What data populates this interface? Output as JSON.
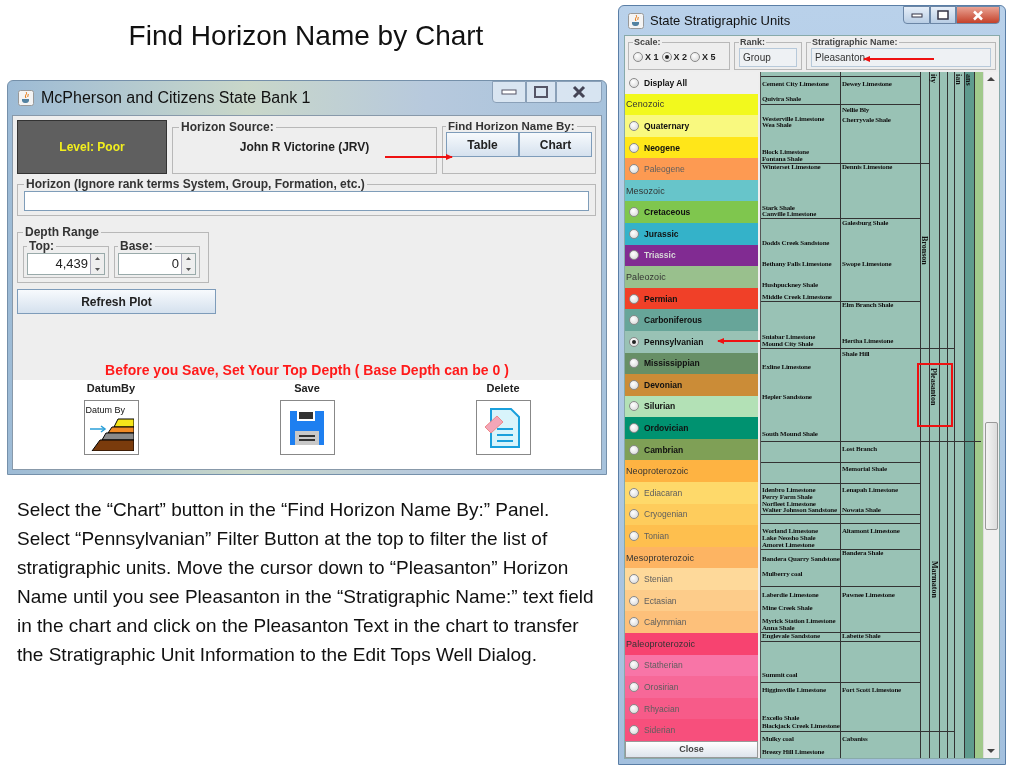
{
  "slide": {
    "title": "Find Horizon Name by Chart",
    "instructions": "Select the “Chart” button in the “Find Horizon Name By:” Panel. Select “Pennsylvanian” Filter Button at the top to filter the list of stratigraphic units. Move the cursor down to “Pleasanton” Horizon Name until you see Pleasanton in the “Stratigraphic Name:” text field in the chart and click on the Pleasanton Text in the chart to transfer the Stratigraphic Unit Information to the Edit Tops Well Dialog."
  },
  "edit_window": {
    "title": "McPherson and Citizens State Bank 1",
    "level": "Level: Poor",
    "horizon_source": {
      "label": "Horizon Source:",
      "value": "John R Victorine (JRV)"
    },
    "find_by": {
      "label": "Find Horizon Name By:",
      "buttons": [
        "Table",
        "Chart"
      ]
    },
    "horizon": {
      "label": "Horizon (Ignore rank terms System, Group, Formation, etc.)"
    },
    "depth_range": {
      "label": "Depth Range",
      "top": {
        "label": "Top:",
        "value": "4,439"
      },
      "base": {
        "label": "Base:",
        "value": "0"
      }
    },
    "refresh_button": "Refresh Plot",
    "warning": "Before you Save, Set Your Top Depth ( Base Depth can be 0 )",
    "actions": [
      {
        "label": "DatumBy",
        "kind": "datum",
        "icon_text": "Datum By"
      },
      {
        "label": "Save",
        "kind": "save"
      },
      {
        "label": "Delete",
        "kind": "delete"
      }
    ]
  },
  "strat_window": {
    "title": "State Stratigraphic Units",
    "scale": {
      "label": "Scale:",
      "options": [
        {
          "label": "X 1",
          "selected": false
        },
        {
          "label": "X 2",
          "selected": true
        },
        {
          "label": "X 5",
          "selected": false
        }
      ]
    },
    "rank": {
      "label": "Rank:",
      "value": "Group"
    },
    "name": {
      "label": "Stratigraphic Name:",
      "value": "Pleasanton"
    },
    "filters": [
      {
        "kind": "radio",
        "label": "Display All",
        "color": "#efefef",
        "selected": false,
        "disabled": false
      },
      {
        "kind": "header",
        "label": "Cenozoic",
        "color": "#f2f91d",
        "disabled": false
      },
      {
        "kind": "radio",
        "label": "Quaternary",
        "color": "#f9f97f",
        "selected": false,
        "disabled": false
      },
      {
        "kind": "radio",
        "label": "Neogene",
        "color": "#ffe619",
        "selected": false,
        "disabled": false
      },
      {
        "kind": "radio",
        "label": "Paleogene",
        "color": "#fd9a52",
        "selected": false,
        "disabled": true
      },
      {
        "kind": "header",
        "label": "Mesozoic",
        "color": "#67c5ca",
        "disabled": false
      },
      {
        "kind": "radio",
        "label": "Cretaceous",
        "color": "#7fc64e",
        "selected": false,
        "disabled": false
      },
      {
        "kind": "radio",
        "label": "Jurassic",
        "color": "#34b2c9",
        "selected": false,
        "disabled": false
      },
      {
        "kind": "radio",
        "label": "Triassic",
        "color": "#812b92",
        "selected": false,
        "disabled": true
      },
      {
        "kind": "header",
        "label": "Paleozoic",
        "color": "#99c08d",
        "disabled": false
      },
      {
        "kind": "radio",
        "label": "Permian",
        "color": "#f04028",
        "selected": false,
        "disabled": false
      },
      {
        "kind": "radio",
        "label": "Carboniferous",
        "color": "#67a599",
        "selected": false,
        "disabled": false
      },
      {
        "kind": "radio",
        "label": "Pennsylvanian",
        "color": "#99c2b5",
        "selected": true,
        "disabled": false
      },
      {
        "kind": "radio",
        "label": "Mississippian",
        "color": "#678f66",
        "selected": false,
        "disabled": false
      },
      {
        "kind": "radio",
        "label": "Devonian",
        "color": "#cb8c37",
        "selected": false,
        "disabled": false
      },
      {
        "kind": "radio",
        "label": "Silurian",
        "color": "#b3e1b6",
        "selected": false,
        "disabled": false
      },
      {
        "kind": "radio",
        "label": "Ordovician",
        "color": "#009270",
        "selected": false,
        "disabled": false
      },
      {
        "kind": "radio",
        "label": "Cambrian",
        "color": "#7fa056",
        "selected": false,
        "disabled": false
      },
      {
        "kind": "header",
        "label": "Neoproterozoic",
        "color": "#feb342",
        "disabled": false
      },
      {
        "kind": "radio",
        "label": "Ediacaran",
        "color": "#fed96a",
        "selected": false,
        "disabled": true
      },
      {
        "kind": "radio",
        "label": "Cryogenian",
        "color": "#fecc5c",
        "selected": false,
        "disabled": true
      },
      {
        "kind": "radio",
        "label": "Tonian",
        "color": "#febf4e",
        "selected": false,
        "disabled": true
      },
      {
        "kind": "header",
        "label": "Mesoproterozoic",
        "color": "#fdb462",
        "disabled": false
      },
      {
        "kind": "radio",
        "label": "Stenian",
        "color": "#fed99a",
        "selected": false,
        "disabled": true
      },
      {
        "kind": "radio",
        "label": "Ectasian",
        "color": "#fdcc8a",
        "selected": false,
        "disabled": true
      },
      {
        "kind": "radio",
        "label": "Calymmian",
        "color": "#fdc07a",
        "selected": false,
        "disabled": true
      },
      {
        "kind": "header",
        "label": "Paleoproterozoic",
        "color": "#f74370",
        "disabled": false
      },
      {
        "kind": "radio",
        "label": "Statherian",
        "color": "#f875a7",
        "selected": false,
        "disabled": true
      },
      {
        "kind": "radio",
        "label": "Orosirian",
        "color": "#f76898",
        "selected": false,
        "disabled": true
      },
      {
        "kind": "radio",
        "label": "Rhyacian",
        "color": "#f75b89",
        "selected": false,
        "disabled": true
      },
      {
        "kind": "radio",
        "label": "Siderian",
        "color": "#f74f7c",
        "selected": false,
        "disabled": true
      }
    ],
    "close_button": "Close",
    "chart": {
      "column_1": [
        "Cement City Limestone",
        "Quivira Shale",
        "Westerville Limestone",
        "Wea Shale",
        "Block Limestone",
        "Fontana Shale",
        "Winterset Limestone",
        "Stark Shale",
        "Canville Limestone",
        "Dodds Creek Sandstone",
        "Bethany Falls Limestone",
        "Hushpuckney Shale",
        "Middle Creek Limestone",
        "Sniabar Limestone",
        "Mound City Shale",
        "Exline Limestone",
        "Hepler Sandstone",
        "South Mound Shale",
        "Idenbro Limestone",
        "Perry Farm Shale",
        "Norfleet Limestone",
        "Walter Johnson Sandstone",
        "Worland Limestone",
        "Lake Neosho Shale",
        "Amoret Limestone",
        "Bandera Quarry Sandstone",
        "Mulberry coal",
        "Laberdie Limestone",
        "Mine Creek Shale",
        "Myrick Station Limestone",
        "Anna Shale",
        "Englevale Sandstone",
        "Summit coal",
        "Higginsville Limestone",
        "Excello Shale",
        "Blackjack Creek Limestone",
        "Mulky coal",
        "Breezy Hill Limestone"
      ],
      "column_2": [
        "Dewey Limestone",
        "Nellie Bly",
        "Cherryvale Shale",
        "Dennis Limestone",
        "Galesburg Shale",
        "Swope Limestone",
        "Elm Branch Shale",
        "Hertha Limestone",
        "Shale Hill",
        "Lost Branch",
        "Memorial Shale",
        "Lenapah Limestone",
        "Nowata Shale",
        "Altamont Limestone",
        "Bandera Shale",
        "Pawnee Limestone",
        "Labette Shale",
        "Fort Scott Limestone",
        "Cabaniss"
      ],
      "vertical_labels": [
        "ity",
        "ian",
        "ans",
        "Bronson",
        "Pleasanton",
        "Marmaton"
      ]
    }
  }
}
